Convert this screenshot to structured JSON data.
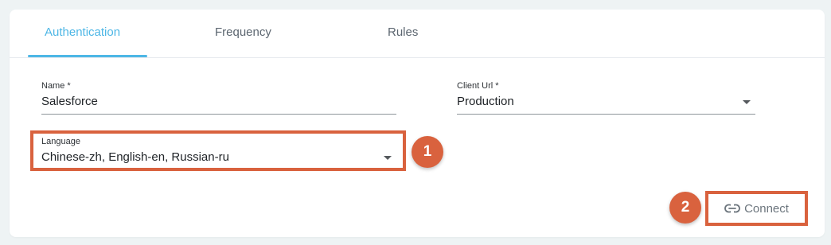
{
  "tabs": [
    {
      "label": "Authentication",
      "active": true
    },
    {
      "label": "Frequency",
      "active": false
    },
    {
      "label": "Rules",
      "active": false
    }
  ],
  "form": {
    "name": {
      "label": "Name *",
      "value": "Salesforce"
    },
    "client_url": {
      "label": "Client Url *",
      "value": "Production"
    },
    "language": {
      "label": "Language",
      "value": "Chinese-zh, English-en, Russian-ru"
    }
  },
  "actions": {
    "connect_label": "Connect",
    "connect_icon": "link-icon"
  },
  "annotations": {
    "step_1": "1",
    "step_2": "2"
  },
  "colors": {
    "accent": "#4eb7e6",
    "annotation": "#d9623e",
    "background": "#eef3f4"
  }
}
